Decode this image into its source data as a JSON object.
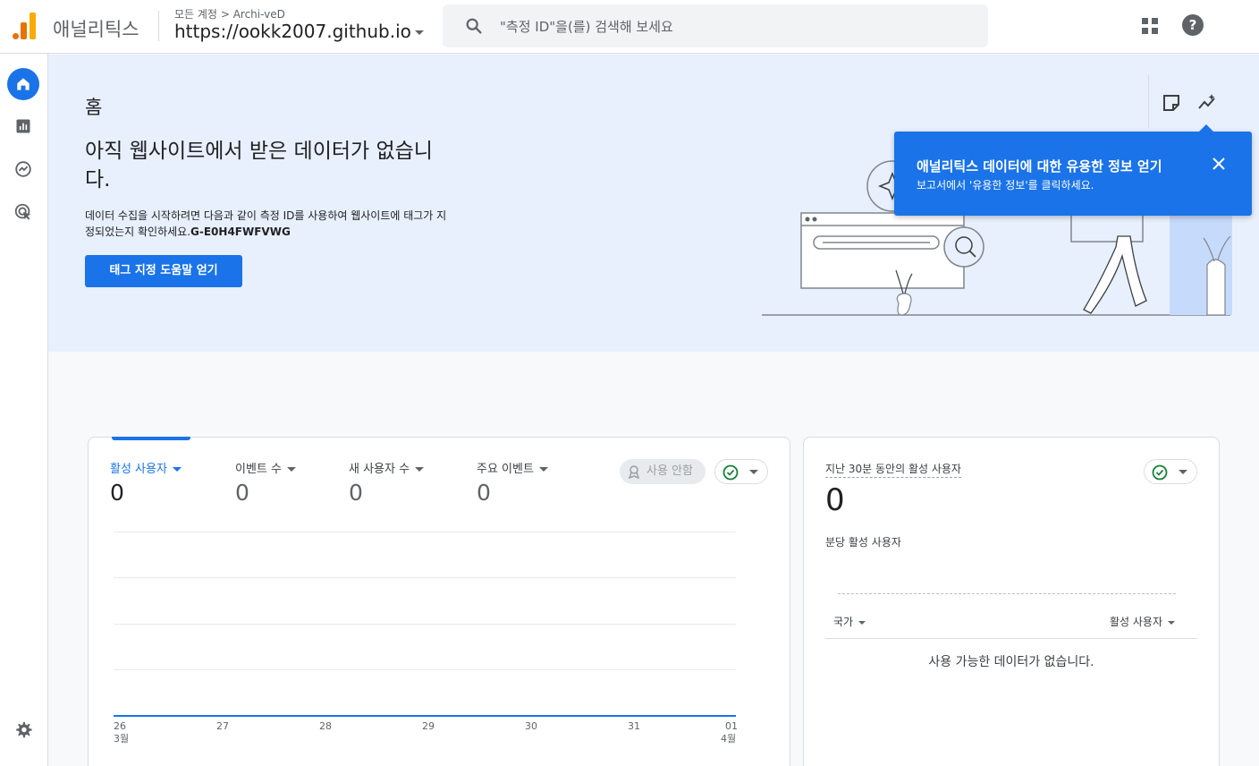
{
  "app": {
    "name": "애널리틱스",
    "breadcrumb_root": "모든 계정",
    "breadcrumb_separator": ">",
    "breadcrumb_account": "Archi-veD",
    "property": "https://ookk2007.github.io"
  },
  "search": {
    "placeholder": "\"측정 ID\"을(를) 검색해 보세요"
  },
  "nav": {
    "items": [
      {
        "icon": "home-icon",
        "active": true
      },
      {
        "icon": "reports-icon",
        "active": false
      },
      {
        "icon": "explore-icon",
        "active": false
      },
      {
        "icon": "advertising-icon",
        "active": false
      }
    ],
    "settings_icon": "gear-icon"
  },
  "hero": {
    "title": "홈",
    "headline": "아직 웹사이트에서 받은 데이터가 없습니다.",
    "description": "데이터 수집을 시작하려면 다음과 같이 측정 ID를 사용하여 웹사이트에 태그가 지정되었는지 확인하세요.",
    "measurement_id": "G-E0H4FWFVWG",
    "button_label": "태그 지정 도움말 얻기"
  },
  "tooltip": {
    "title": "애널리틱스 데이터에 대한 유용한 정보 얻기",
    "subtitle": "보고서에서 '유용한 정보'를 클릭하세요."
  },
  "overview_card": {
    "metrics": [
      {
        "label": "활성 사용자",
        "value": "0",
        "active": true
      },
      {
        "label": "이벤트 수",
        "value": "0",
        "active": false
      },
      {
        "label": "새 사용자 수",
        "value": "0",
        "active": false
      },
      {
        "label": "주요 이벤트",
        "value": "0",
        "active": false
      }
    ],
    "disabled_label": "사용 안함",
    "chart_ticks": [
      "26",
      "27",
      "28",
      "29",
      "30",
      "31",
      "01"
    ],
    "month_start": "3월",
    "month_end": "4월"
  },
  "chart_data": {
    "type": "line",
    "x": [
      "3월 26",
      "3월 27",
      "3월 28",
      "3월 29",
      "3월 30",
      "3월 31",
      "4월 01"
    ],
    "series": [
      {
        "values": [
          0,
          0,
          0,
          0,
          0,
          0,
          0
        ]
      }
    ]
  },
  "realtime_card": {
    "title": "지난 30분 동안의 활성 사용자",
    "value": "0",
    "per_minute_label": "분당 활성 사용자",
    "col_country": "국가",
    "col_active_users": "활성 사용자",
    "empty_message": "사용 가능한 데이터가 없습니다."
  },
  "colors": {
    "accent": "#1a73e8",
    "hero_bg": "#e8f0fe",
    "logo_orange": "#f9ab00",
    "logo_dark_orange": "#e37400",
    "status_green": "#188038"
  }
}
